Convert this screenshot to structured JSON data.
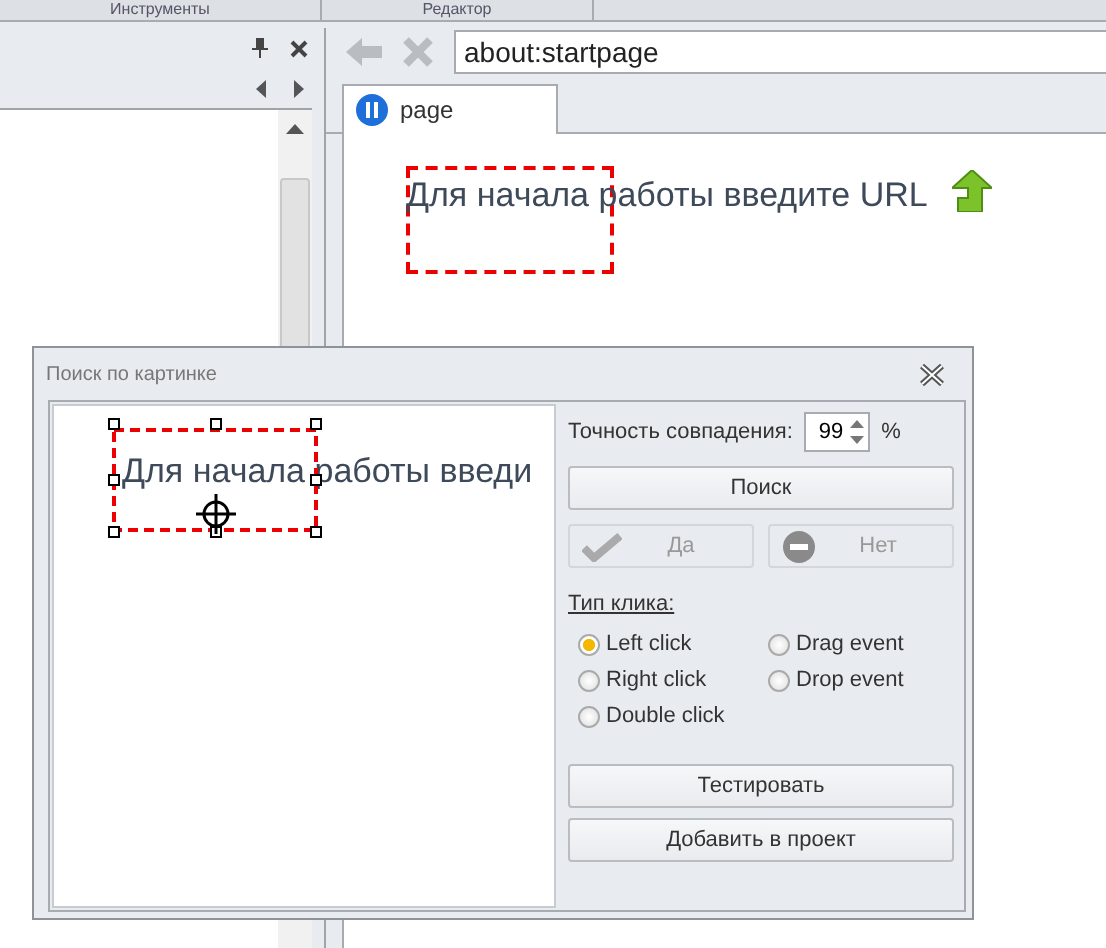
{
  "top_tabs": [
    {
      "label": "Инструменты"
    },
    {
      "label": "Редактор"
    }
  ],
  "browser": {
    "url": "about:startpage",
    "tab": {
      "label": "page",
      "selected": true
    },
    "content_text": "Для начала работы введите URL"
  },
  "dialog": {
    "title": "Поиск по картинке",
    "preview_text": "Для начала работы введи",
    "accuracy": {
      "label": "Точность совпадения:",
      "value": "99",
      "unit": "%"
    },
    "search_button": "Поиск",
    "answer_buttons": [
      {
        "label": "Да",
        "kind": "yes",
        "disabled": true
      },
      {
        "label": "Нет",
        "kind": "no",
        "disabled": true
      }
    ],
    "click_type_label": "Тип клика:",
    "click_types": [
      {
        "label": "Left click",
        "selected": true
      },
      {
        "label": "Drag event",
        "selected": false
      },
      {
        "label": "Right click",
        "selected": false
      },
      {
        "label": "Drop event",
        "selected": false
      },
      {
        "label": "Double click",
        "selected": false
      }
    ],
    "bottom_buttons": [
      "Тестировать",
      "Добавить в проект"
    ]
  }
}
